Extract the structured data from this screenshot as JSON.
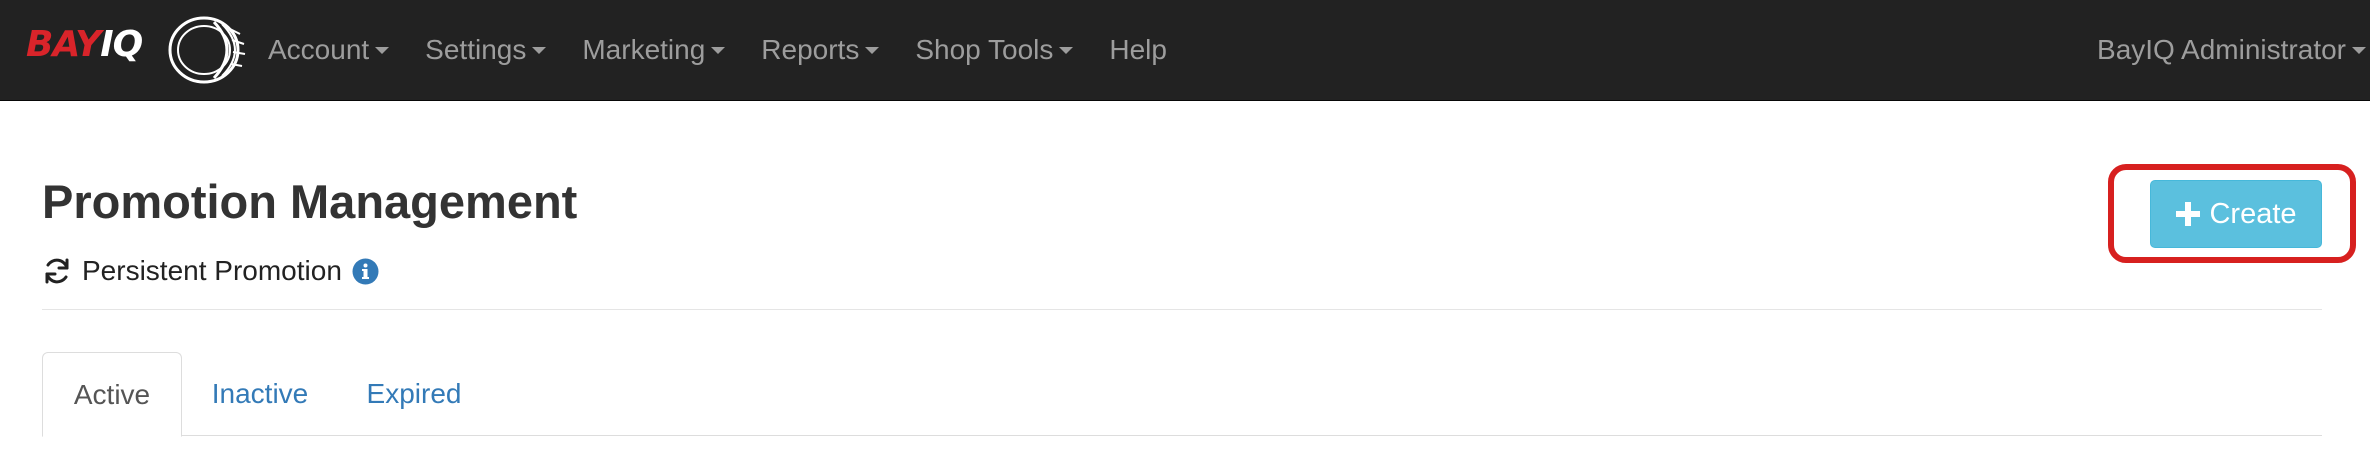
{
  "brand": {
    "logo_text_part1": "BAY",
    "logo_text_part2": "IQ"
  },
  "nav": {
    "items": [
      {
        "label": "Account",
        "dropdown": true
      },
      {
        "label": "Settings",
        "dropdown": true
      },
      {
        "label": "Marketing",
        "dropdown": true
      },
      {
        "label": "Reports",
        "dropdown": true
      },
      {
        "label": "Shop Tools",
        "dropdown": true
      },
      {
        "label": "Help",
        "dropdown": false
      }
    ],
    "user_label": "BayIQ Administrator"
  },
  "header": {
    "title": "Promotion Management",
    "subtitle": "Persistent Promotion",
    "refresh_icon": "refresh-icon",
    "info_icon": "info-circle-icon"
  },
  "actions": {
    "create_label": "Create",
    "create_icon": "plus-icon"
  },
  "tabs": [
    {
      "label": "Active",
      "active": true
    },
    {
      "label": "Inactive",
      "active": false
    },
    {
      "label": "Expired",
      "active": false
    }
  ],
  "colors": {
    "navbar_bg": "#222222",
    "nav_text": "#9d9d9d",
    "brand_red": "#d9242a",
    "create_button_bg": "#5bc0de",
    "highlight_border": "#d7201f",
    "link_blue": "#337ab7",
    "info_icon": "#337ab7"
  }
}
